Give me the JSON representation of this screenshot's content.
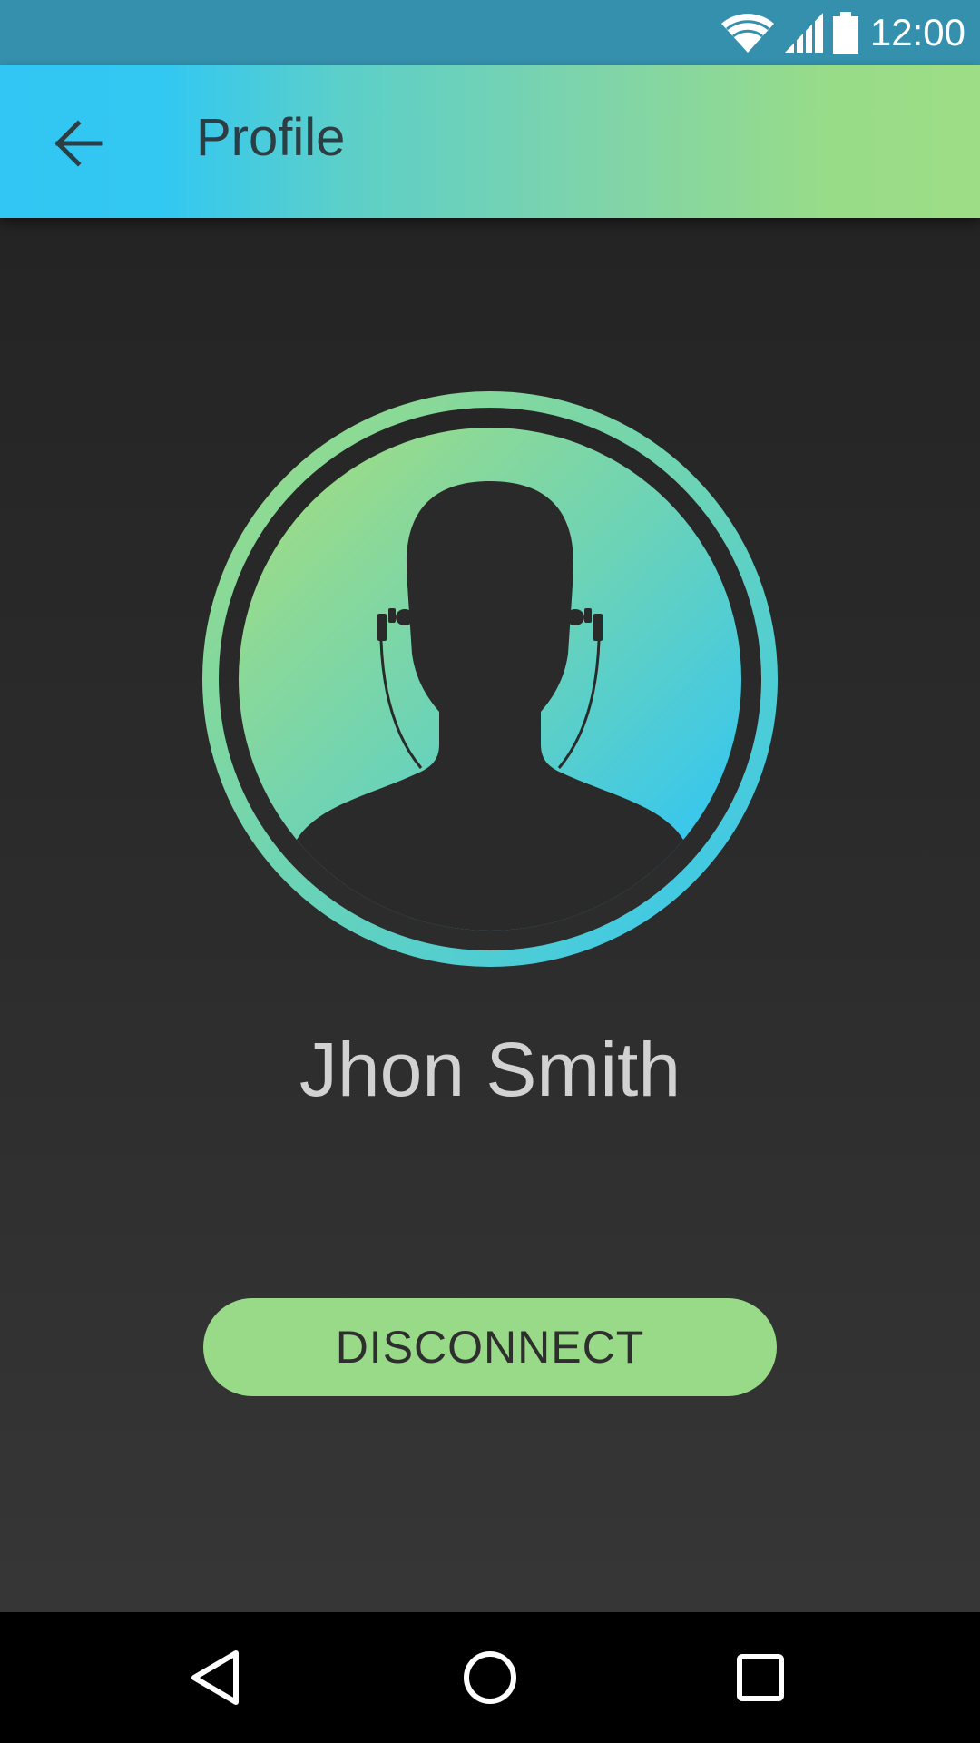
{
  "status_bar": {
    "time": "12:00",
    "icons": [
      "wifi-icon",
      "cell-signal-icon",
      "battery-icon"
    ],
    "background": "#3590ad"
  },
  "app_bar": {
    "title": "Profile",
    "back_icon": "arrow-back-icon",
    "gradient": [
      "#32c6f4",
      "#9ddd86"
    ]
  },
  "profile": {
    "avatar_icon": "user-headphones-icon",
    "name": "Jhon Smith"
  },
  "actions": {
    "disconnect_label": "DISCONNECT",
    "disconnect_color": "#98da88"
  },
  "nav_bar": {
    "items": [
      "back-triangle-icon",
      "home-circle-icon",
      "recents-square-icon"
    ]
  }
}
